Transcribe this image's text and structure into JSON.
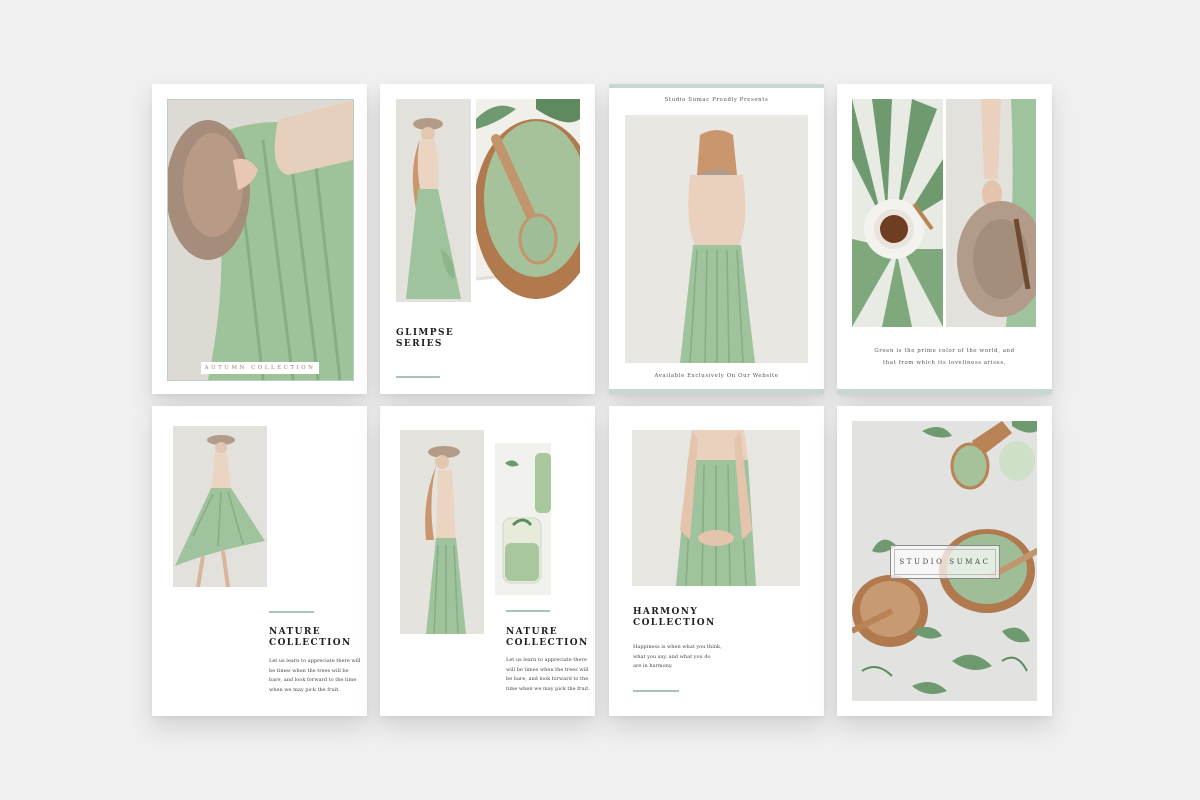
{
  "cards": {
    "c1": {
      "label": "AUTUMN COLLECTION"
    },
    "c2": {
      "title": "GLIMPSE\nSERIES"
    },
    "c3": {
      "top": "Studio Sumac Proudly Presents",
      "bottom": "Available Exclusively On Our Website"
    },
    "c4": {
      "quote1": "Green is the prime color of the world, and",
      "quote2": "that from which its loveliness arises."
    },
    "c5": {
      "title": "NATURE\nCOLLECTION",
      "body": [
        "Let us learn to appreciate there will",
        "be times when the trees will be",
        "bare, and look forward to the time",
        "when we may pick the fruit."
      ]
    },
    "c6": {
      "title": "NATURE\nCOLLECTION",
      "body": [
        "Let us learn to appreciate there",
        "will be times when the trees will",
        "be bare, and look forward to the",
        "time when we may pick the fruit."
      ]
    },
    "c7": {
      "title": "HARMONY\nCOLLECTION",
      "body": [
        "Happiness is when what you think,",
        "what you say, and what you do",
        "are in harmony."
      ]
    },
    "c8": {
      "brand": "STUDIO SUMAC"
    }
  },
  "colors": {
    "accent": "#a8c2bd",
    "skirt_green": "#9fc39c",
    "background": "#f0f0f0"
  }
}
